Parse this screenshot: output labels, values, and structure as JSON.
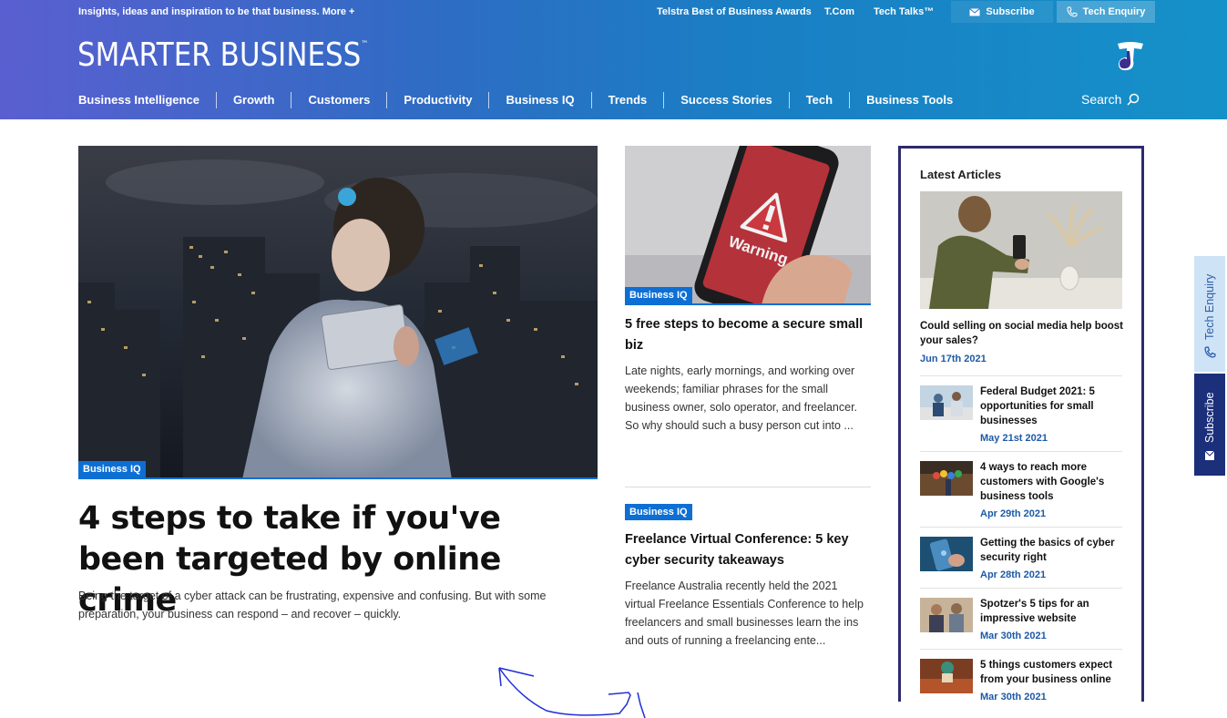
{
  "topbar": {
    "tagline": "Insights, ideas and inspiration to be that business. More +",
    "links": [
      "Telstra Best of Business Awards",
      "T.Com",
      "Tech Talks™"
    ],
    "subscribe": "Subscribe",
    "tech_enquiry": "Tech Enquiry"
  },
  "brand": {
    "name": "SMARTER BUSINESS",
    "mark": "™"
  },
  "nav": {
    "items": [
      "Business Intelligence",
      "Growth",
      "Customers",
      "Productivity",
      "Business IQ",
      "Trends",
      "Success Stories",
      "Tech",
      "Business Tools"
    ],
    "search": "Search"
  },
  "hero": {
    "tag": "Business IQ",
    "title": "4 steps to take if you've been targeted by online crime",
    "desc": "Being the target of a cyber attack can be frustrating, expensive and confusing. But with some preparation, your business can respond – and recover – quickly."
  },
  "mid": [
    {
      "tag": "Business IQ",
      "img_text": "Warning",
      "title": "5 free steps to become a secure small biz",
      "desc": "Late nights, early mornings, and working over weekends; familiar phrases for the small business owner, solo operator, and freelancer. So why should such a busy person cut into ..."
    },
    {
      "tag": "Business IQ",
      "title": "Freelance Virtual Conference: 5 key cyber security takeaways",
      "desc": "Freelance Australia recently held the 2021 virtual Freelance Essentials Conference to help freelancers and small businesses learn the ins and outs of running a freelancing ente..."
    }
  ],
  "sidebar": {
    "heading": "Latest Articles",
    "featured": {
      "title": "Could selling on social media help boost your sales?",
      "date": "Jun 17th 2021"
    },
    "items": [
      {
        "title": "Federal Budget 2021: 5 opportunities for small businesses",
        "date": "May 21st 2021"
      },
      {
        "title": "4 ways to reach more customers with Google's business tools",
        "date": "Apr 29th 2021"
      },
      {
        "title": "Getting the basics of cyber security right",
        "date": "Apr 28th 2021"
      },
      {
        "title": "Spotzer's 5 tips for an impressive website",
        "date": "Mar 30th 2021"
      },
      {
        "title": "5 things customers expect from your business online",
        "date": "Mar 30th 2021"
      }
    ]
  },
  "side_tabs": {
    "tech_enquiry": "Tech Enquiry",
    "subscribe": "Subscribe"
  },
  "colors": {
    "accent": "#0d6fd4",
    "sidebar_border": "#2d2a6e",
    "subscribe_tab": "#1b2f7a",
    "annotation": "#1f2fd6"
  }
}
